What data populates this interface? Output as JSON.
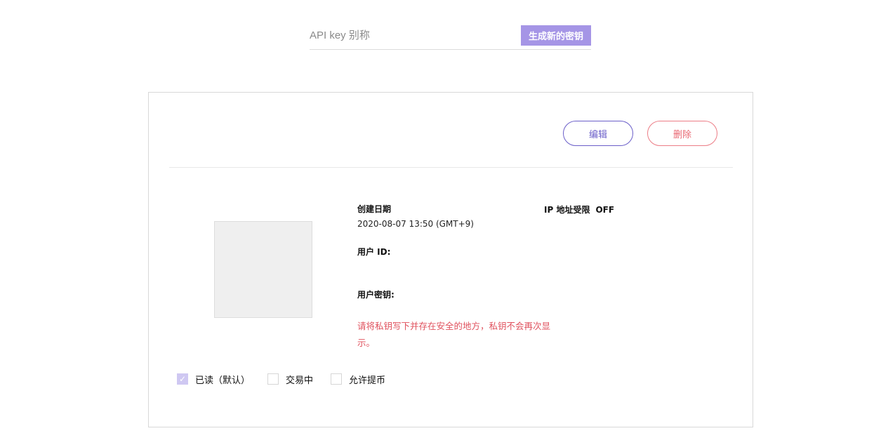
{
  "apikey_form": {
    "alias_placeholder": "API key 别称",
    "generate_label": "生成新的密钥"
  },
  "key_card": {
    "edit_label": "编辑",
    "delete_label": "删除",
    "created_label": "创建日期",
    "created_value": "2020-08-07 13:50 (GMT+9)",
    "ip_label": "IP 地址受限",
    "ip_value": "OFF",
    "user_id_label": "用户 ID:",
    "user_id_value": "",
    "secret_label": "用户密钥:",
    "secret_value": "",
    "warning": "请将私钥写下并存在安全的地方，私钥不会再次显示。",
    "permissions": [
      {
        "label": "已读（默认）",
        "checked": true
      },
      {
        "label": "交易中",
        "checked": false
      },
      {
        "label": "允许提币",
        "checked": false
      }
    ]
  },
  "colors": {
    "accent": "#a595e6",
    "edit": "#6b5fc9",
    "delete": "#e96873",
    "warning": "#e0525e"
  }
}
